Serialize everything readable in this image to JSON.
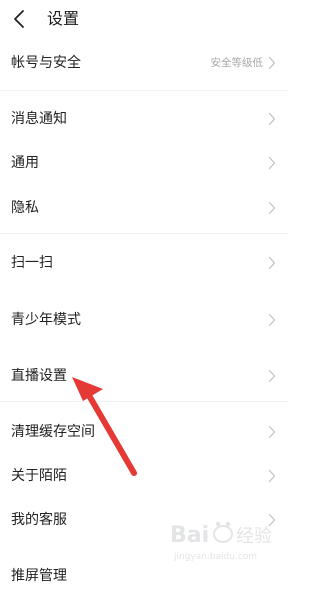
{
  "header": {
    "title": "设置",
    "back_icon": "chevron-left-icon"
  },
  "settings": [
    {
      "label": "帐号与安全",
      "value": "安全等级低"
    },
    {
      "label": "消息通知"
    },
    {
      "label": "通用"
    },
    {
      "label": "隐私"
    },
    {
      "label": "扫一扫"
    },
    {
      "label": "青少年模式"
    },
    {
      "label": "直播设置"
    },
    {
      "label": "清理缓存空间"
    },
    {
      "label": "关于陌陌"
    },
    {
      "label": "我的客服"
    },
    {
      "label": "推屏管理"
    }
  ],
  "annotation": {
    "arrow_color": "#e53935",
    "points_to": "直播设置"
  },
  "watermark": {
    "brand": "Baidu",
    "cn": "经验",
    "url": "jingyan.baidu.com"
  }
}
